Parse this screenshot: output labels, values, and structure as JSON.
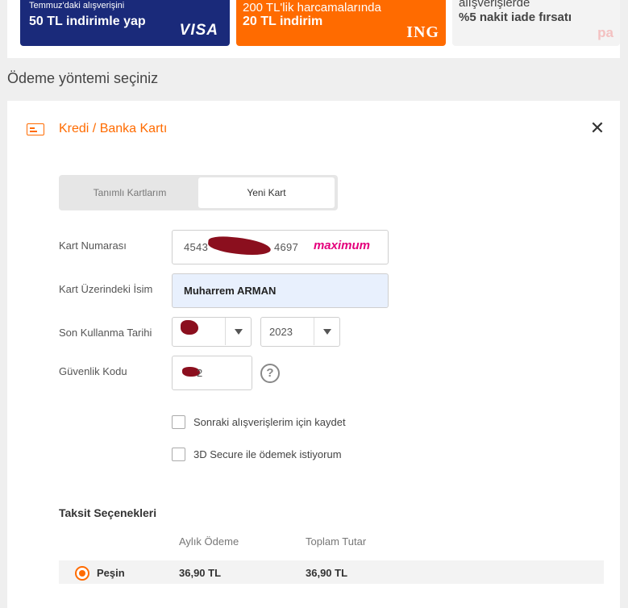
{
  "promos": [
    {
      "line1": "Temmuz'daki alışverişini",
      "line2": "50 TL indirimle yap",
      "logo": "VISA"
    },
    {
      "line1": "200 TL'lik harcamalarında",
      "line2": "20 TL indirim",
      "logo": "ING"
    },
    {
      "line1": "alışverişlerde",
      "line2": "%5 nakit iade fırsatı",
      "logo": "pa"
    }
  ],
  "section_title": "Ödeme yöntemi seçiniz",
  "panel": {
    "title": "Kredi / Banka Kartı",
    "close": "✕",
    "tabs": [
      {
        "label": "Tanımlı Kartlarım",
        "active": false
      },
      {
        "label": "Yeni Kart",
        "active": true
      }
    ]
  },
  "form": {
    "card_number_label": "Kart Numarası",
    "card_number_start": "4543",
    "card_number_end": "4697",
    "card_brand": "maximum",
    "name_label": "Kart Üzerindeki İsim",
    "name_value": "Muharrem ARMAN",
    "expiry_label": "Son Kullanma Tarihi",
    "expiry_month": "",
    "expiry_year": "2023",
    "cvv_label": "Güvenlik Kodu",
    "cvv_value": "2",
    "help": "?",
    "save_card_label": "Sonraki alışverişlerim için kaydet",
    "secure_label": "3D Secure ile ödemek istiyorum"
  },
  "installments": {
    "title": "Taksit Seçenekleri",
    "headers": [
      "Aylık Ödeme",
      "Toplam Tutar"
    ],
    "rows": [
      {
        "label": "Peşin",
        "monthly": "36,90 TL",
        "total": "36,90 TL",
        "selected": true
      }
    ]
  },
  "colors": {
    "accent": "#ff6b00",
    "visa_blue": "#1a2a7a",
    "maximum_pink": "#e4007c"
  }
}
